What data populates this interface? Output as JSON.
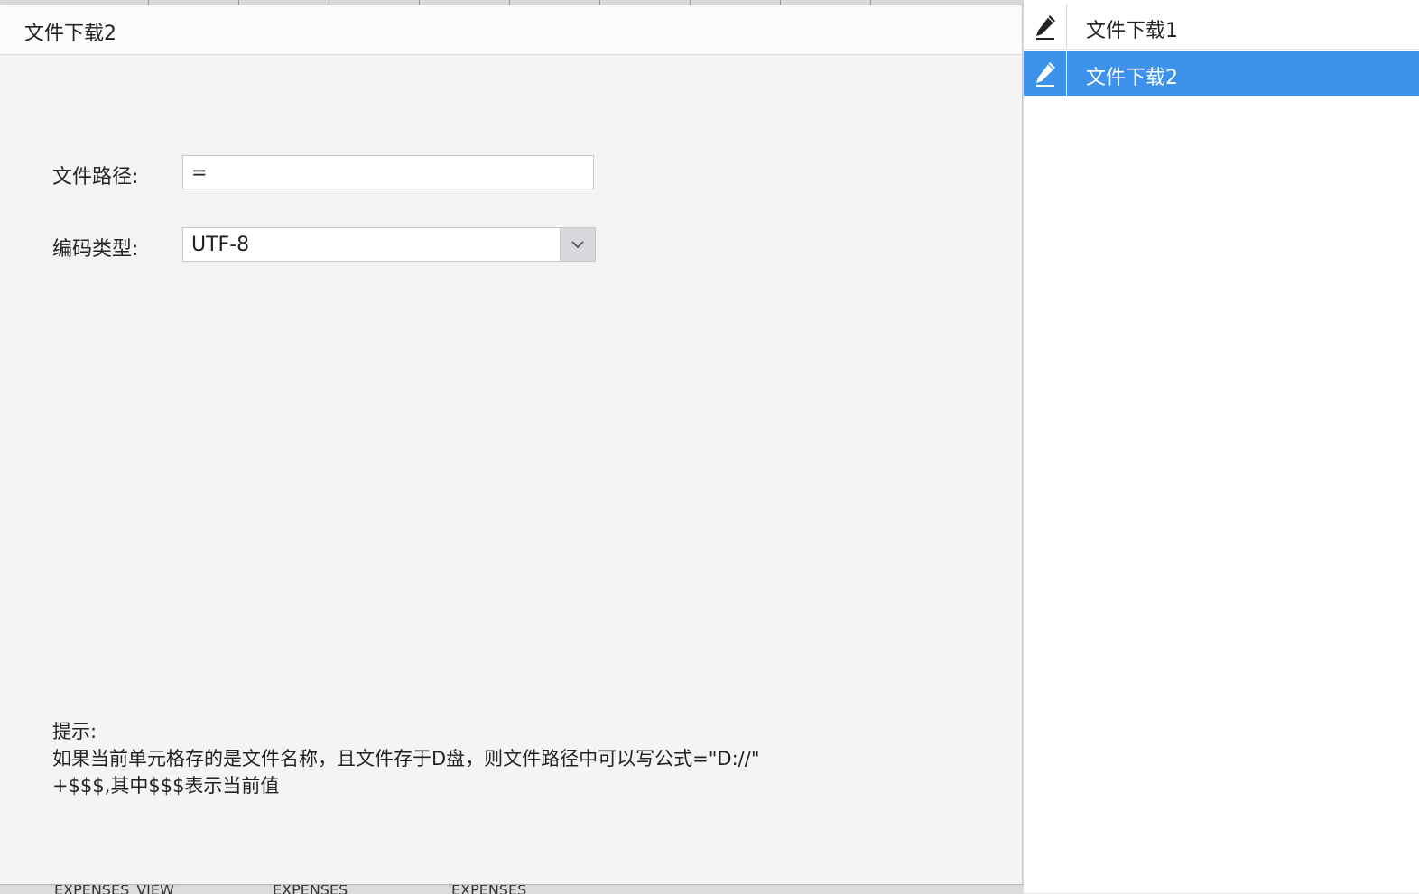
{
  "dialog": {
    "title": "文件下载2",
    "file_path": {
      "label": "文件路径:",
      "value": "="
    },
    "encoding": {
      "label": "编码类型:",
      "selected": "UTF-8",
      "arrow_icon": "chevron-down-icon"
    },
    "hint": {
      "title": "提示:",
      "line1": "如果当前单元格存的是文件名称，且文件存于D盘，则文件路径中可以写公式=\"D://\"",
      "line2": "+$$$,其中$$$表示当前值"
    }
  },
  "list": {
    "items": [
      {
        "label": "文件下载1",
        "icon": "pencil-icon",
        "selected": false
      },
      {
        "label": "文件下载2",
        "icon": "pencil-icon",
        "selected": true
      }
    ],
    "selected_color": "#3d92ec"
  },
  "background": {
    "sheet_tabs": [
      "EXPENSES_VIEW",
      "EXPENSES",
      "EXPENSES"
    ]
  }
}
